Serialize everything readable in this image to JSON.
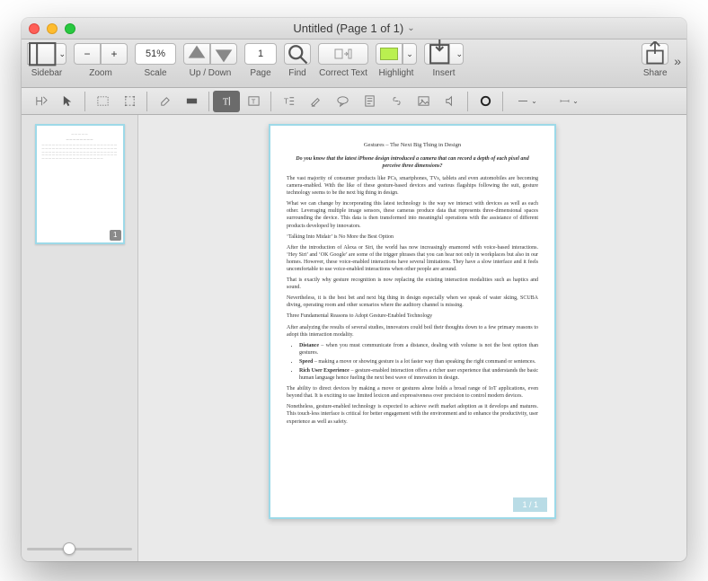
{
  "window": {
    "title": "Untitled (Page 1 of 1)"
  },
  "toolbar": {
    "sidebar": "Sidebar",
    "zoom": "Zoom",
    "zoom_value": "51%",
    "scale": "Scale",
    "updown": "Up / Down",
    "page": "Page",
    "page_value": "1",
    "find": "Find",
    "correct": "Correct Text",
    "highlight": "Highlight",
    "insert": "Insert",
    "share": "Share",
    "minus": "−",
    "plus": "+"
  },
  "thumb": {
    "page_num": "1"
  },
  "doc": {
    "title": "Gestures – The Next Big Thing in Design",
    "question": "Do you know that the latest iPhone design introduced a camera that can record a depth of each pixel and perceive three dimensions?",
    "p1": "The vast majority of consumer products like PCs, smartphones, TVs, tablets and even automobiles are becoming camera-enabled. With the like of these gesture-based devices and various flagships following the suit, gesture technology seems to be the next big thing in design.",
    "p2": "What we can change by incorporating this latest technology is the way we interact with devices as well as each other. Leveraging multiple image sensors, these cameras produce data that represents three-dimensional spaces surrounding the device. This data is then transformed into meaningful operations with the assistance of different products developed by innovators.",
    "h2a": "‘Talking Into Midair’ is No More the Best Option",
    "p3": "After the introduction of Alexa or Siri, the world has now increasingly enamored with voice-based interactions. ‘Hey Siri’ and ‘OK Google’ are some of the trigger phrases that you can hear not only in workplaces but also in our homes. However, these voice-enabled interactions have several limitations. They have a slow interface and it feels uncomfortable to use voice-enabled interactions when other people are around.",
    "p4": "That is exactly why gesture recognition is now replacing the existing interaction modalities such as haptics and sound.",
    "p5": "Nevertheless, it is the best bet and next big thing in design especially when we speak of water skiing, SCUBA diving, operating room and other scenarios where the auditory channel is missing.",
    "h2b": "Three Fundamental Reasons to Adopt Gesture-Enabled Technology",
    "p6": "After analyzing the results of several studies, innovators could boil their thoughts down to a few primary reasons to adopt this interaction modality.",
    "b1t": "Distance",
    "b1": " – when you must communicate from a distance, dealing with volume is not the best option than gestures.",
    "b2t": "Speed",
    "b2": " – making a move or showing gesture is a lot faster way than speaking the right command or sentences.",
    "b3t": "Rich User Experience",
    "b3": " – gesture-enabled interaction offers a richer user experience that understands the basic human language hence fueling the next best wave of innovation in design.",
    "p7": "The ability to direct devices by making a move or gestures alone holds a broad range of IoT applications, even beyond that. It is exciting to use limited lexicon and expressiveness over precision to control modern devices.",
    "p8": "Nonetheless, gesture-enabled technology is expected to achieve swift market adoption as it develops and matures. This touch-less interface is critical for better engagement with the environment and to enhance the productivity, user experience as well as safety.",
    "footer": "1 / 1"
  }
}
